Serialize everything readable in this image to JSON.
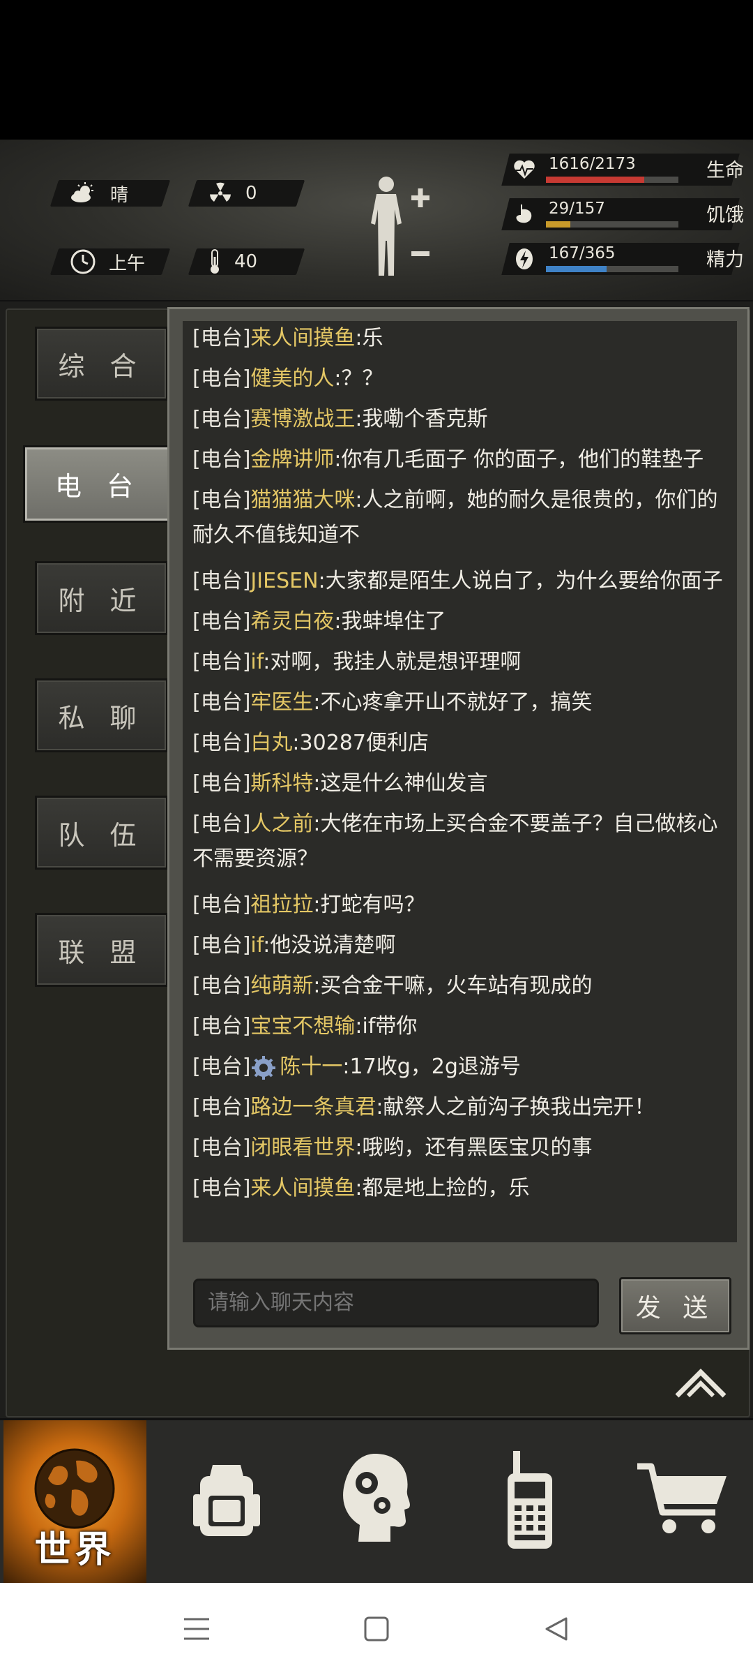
{
  "hud": {
    "weather": "晴",
    "radiation": "0",
    "time_of_day": "上午",
    "temperature": "40"
  },
  "stats": [
    {
      "name": "生命",
      "value": "1616/2173",
      "fill": 0.744,
      "color": "#c73a33",
      "icon": "heart-pulse-icon"
    },
    {
      "name": "饥饿",
      "value": "29/157",
      "fill": 0.185,
      "color": "#c89a2a",
      "icon": "stomach-icon"
    },
    {
      "name": "精力",
      "value": "167/365",
      "fill": 0.458,
      "color": "#3f82c6",
      "icon": "energy-bolt-icon"
    }
  ],
  "tabs": [
    {
      "label": "综 合"
    },
    {
      "label": "电 台"
    },
    {
      "label": "附 近"
    },
    {
      "label": "私 聊"
    },
    {
      "label": "队 伍"
    },
    {
      "label": "联 盟"
    }
  ],
  "active_tab_index": 1,
  "messages": [
    {
      "channel": "[电台]",
      "user": "来人间摸鱼",
      "text": ":乐"
    },
    {
      "channel": "[电台]",
      "user": "健美的人",
      "text": ":？？"
    },
    {
      "channel": "[电台]",
      "user": "赛博激战王",
      "text": ":我嘞个香克斯"
    },
    {
      "channel": "[电台]",
      "user": "金牌讲师",
      "text": ":你有几毛面子 你的面子，他们的鞋垫子"
    },
    {
      "channel": "[电台]",
      "user": "猫猫猫大咪",
      "text": ":人之前啊，她的耐久是很贵的，你们的耐久不值钱知道不"
    },
    {
      "channel": "[电台]",
      "user": "JIESEN",
      "text": ":大家都是陌生人说白了，为什么要给你面子"
    },
    {
      "channel": "[电台]",
      "user": "希灵白夜",
      "text": ":我蚌埠住了"
    },
    {
      "channel": "[电台]",
      "user": "if",
      "text": ":对啊，我挂人就是想评理啊"
    },
    {
      "channel": "[电台]",
      "user": "牢医生",
      "text": ":不心疼拿开山不就好了，搞笑"
    },
    {
      "channel": "[电台]",
      "user": "白丸",
      "text": ":30287便利店"
    },
    {
      "channel": "[电台]",
      "user": "斯科特",
      "text": ":这是什么神仙发言"
    },
    {
      "channel": "[电台]",
      "user": "人之前",
      "text": ":大佬在市场上买合金不要盖子？自己做核心不需要资源？"
    },
    {
      "channel": "[电台]",
      "user": "祖拉拉",
      "text": ":打蛇有吗？"
    },
    {
      "channel": "[电台]",
      "user": "if",
      "text": ":他没说清楚啊"
    },
    {
      "channel": "[电台]",
      "user": "纯萌新",
      "text": ":买合金干嘛，火车站有现成的"
    },
    {
      "channel": "[电台]",
      "user": "宝宝不想输",
      "text": ":if带你"
    },
    {
      "channel": "[电台]",
      "user": "陈十一",
      "text": ":17收g，2g退游号",
      "badge": "gear-badge-icon"
    },
    {
      "channel": "[电台]",
      "user": "路边一条真君",
      "text": ":献祭人之前沟子换我出完开！"
    },
    {
      "channel": "[电台]",
      "user": "闭眼看世界",
      "text": ":哦哟，还有黑医宝贝的事"
    },
    {
      "channel": "[电台]",
      "user": "来人间摸鱼",
      "text": ":都是地上捡的，乐"
    }
  ],
  "chat_input": {
    "placeholder": "请输入聊天内容",
    "value": ""
  },
  "send_label": "发 送",
  "bottom_nav": {
    "world_label": "世界",
    "items": [
      "globe-icon",
      "backpack-icon",
      "head-gears-icon",
      "radio-icon",
      "cart-icon"
    ]
  },
  "colors": {
    "username": "#e4c765",
    "accent_orange": "#f6a233"
  }
}
